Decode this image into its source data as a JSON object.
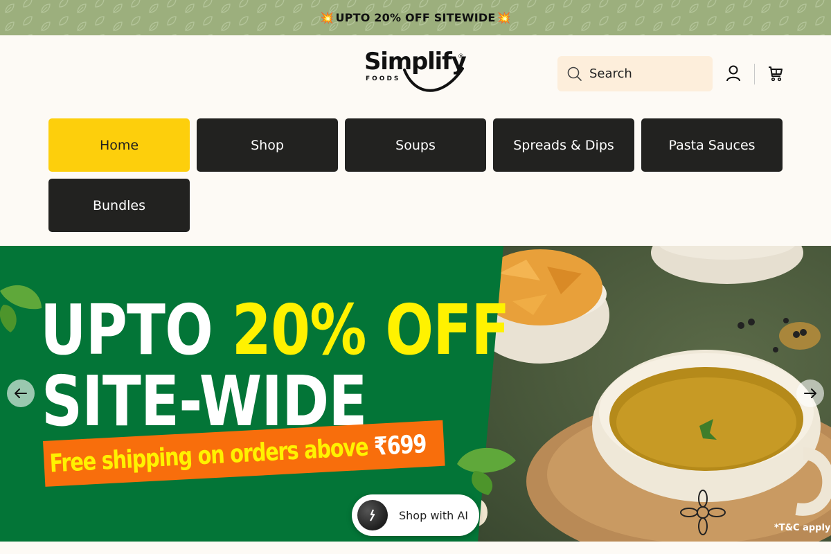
{
  "announcement": {
    "text": "UPTO 20% OFF SITEWIDE",
    "burst_icon": "explosion-emoji"
  },
  "header": {
    "logo": {
      "name": "Simplify",
      "sub": "FOODS",
      "registered": "®"
    },
    "search": {
      "placeholder": "Search",
      "icon": "search-icon"
    },
    "account_icon": "user-icon",
    "cart_icon": "cart-icon"
  },
  "nav": {
    "items": [
      {
        "label": "Home",
        "active": true
      },
      {
        "label": "Shop",
        "active": false
      },
      {
        "label": "Soups",
        "active": false
      },
      {
        "label": "Spreads & Dips",
        "active": false
      },
      {
        "label": "Pasta Sauces",
        "active": false
      },
      {
        "label": "Bundles",
        "active": false
      }
    ]
  },
  "hero": {
    "line1_white": "UPTO",
    "line1_yellow": "20% OFF",
    "line2": "SITE-WIDE",
    "shipping_text": "Free shipping on orders above",
    "shipping_price": "₹699",
    "terms": "*T&C apply",
    "prev_icon": "arrow-left-icon",
    "next_icon": "arrow-right-icon"
  },
  "ai_button": {
    "label": "Shop with AI",
    "icon": "sparkle-icon"
  },
  "colors": {
    "announcement_bg": "#9caf7d",
    "page_bg": "#fdfaf5",
    "nav_active": "#fdcf0c",
    "nav_default": "#222220",
    "hero_green": "#037537",
    "hero_yellow": "#fff200",
    "shipping_band": "#f86e0c",
    "search_bg": "#fdeedb"
  }
}
